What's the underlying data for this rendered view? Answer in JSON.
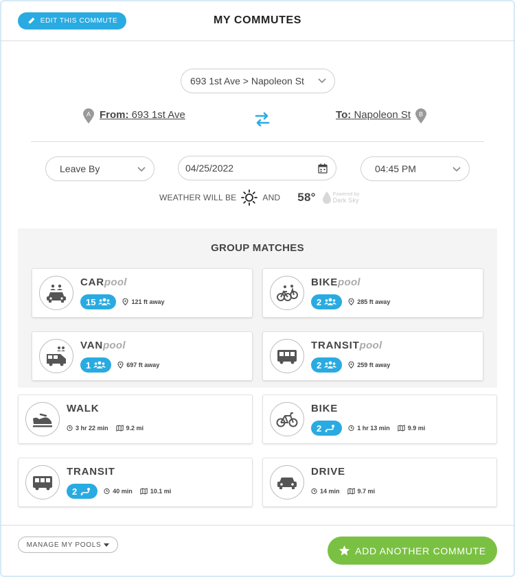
{
  "header": {
    "edit_label": "EDIT THIS COMMUTE",
    "title": "MY COMMUTES"
  },
  "route": {
    "selected": "693 1st Ave > Napoleon St",
    "from_label": "From:",
    "from_value": "693 1st Ave",
    "to_label": "To:",
    "to_value": "Napoleon St",
    "from_pin": "A",
    "to_pin": "B"
  },
  "schedule": {
    "mode": "Leave By",
    "date": "04/25/2022",
    "time": "04:45 PM"
  },
  "weather": {
    "prefix": "WEATHER WILL BE",
    "condition_icon": "sun-icon",
    "joiner": "AND",
    "temperature": "58°",
    "powered_by_line1": "Powered by",
    "powered_by_line2": "Dark Sky"
  },
  "group_matches": {
    "title": "GROUP MATCHES",
    "cards": [
      {
        "title_main": "CAR",
        "title_suffix": "pool",
        "count": "15",
        "distance": "121 ft away",
        "icon": "carpool-icon"
      },
      {
        "title_main": "BIKE",
        "title_suffix": "pool",
        "count": "2",
        "distance": "285 ft away",
        "icon": "bikepool-icon"
      },
      {
        "title_main": "VAN",
        "title_suffix": "pool",
        "count": "1",
        "distance": "697 ft away",
        "icon": "vanpool-icon"
      },
      {
        "title_main": "TRANSIT",
        "title_suffix": "pool",
        "count": "2",
        "distance": "259 ft away",
        "icon": "transitpool-icon"
      }
    ]
  },
  "modes": [
    {
      "title": "WALK",
      "duration": "3 hr 22 min",
      "distance": "9.2 mi",
      "icon": "walk-icon"
    },
    {
      "title": "BIKE",
      "count": "2",
      "duration": "1 hr 13 min",
      "distance": "9.9 mi",
      "icon": "bike-icon"
    },
    {
      "title": "TRANSIT",
      "count": "2",
      "duration": "40 min",
      "distance": "10.1 mi",
      "icon": "bus-icon"
    },
    {
      "title": "DRIVE",
      "duration": "14 min",
      "distance": "9.7 mi",
      "icon": "car-icon"
    }
  ],
  "footer": {
    "manage_label": "MANAGE MY POOLS",
    "add_label": "ADD ANOTHER COMMUTE"
  },
  "colors": {
    "accent_blue": "#29abe2",
    "accent_green": "#7ac143",
    "panel_gray": "#f4f4f4"
  }
}
